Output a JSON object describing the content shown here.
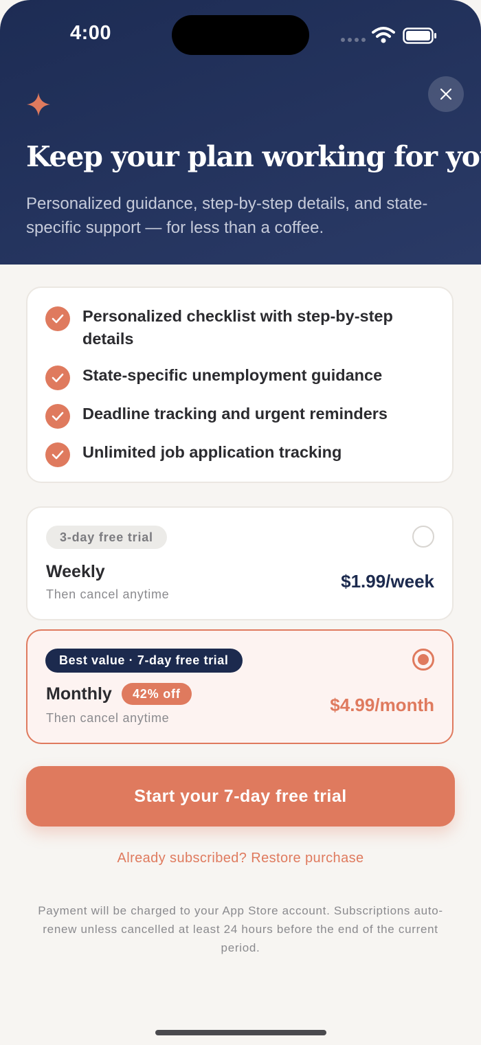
{
  "status_bar": {
    "time": "4:00"
  },
  "header": {
    "title": "Keep your plan working for you",
    "subtitle": "Personalized guidance, step-by-step details, and state-specific support — for less than a coffee.",
    "icons": {
      "sparkle": "sparkle-icon",
      "close": "close-icon"
    }
  },
  "features": [
    {
      "label": "Personalized checklist with step-by-step details"
    },
    {
      "label": "State-specific unemployment guidance"
    },
    {
      "label": "Deadline tracking and urgent reminders"
    },
    {
      "label": "Unlimited job application tracking"
    }
  ],
  "plans": {
    "weekly": {
      "badge": "3-day free trial",
      "name": "Weekly",
      "note": "Then cancel anytime",
      "price": "$1.99/week",
      "selected": false
    },
    "monthly": {
      "badge": "Best value · 7-day free trial",
      "name": "Monthly",
      "discount": "42% off",
      "note": "Then cancel anytime",
      "price": "$4.99/month",
      "selected": true
    }
  },
  "cta": {
    "label": "Start your 7-day free trial"
  },
  "restore": {
    "label": "Already subscribed? Restore purchase"
  },
  "legal": {
    "text": "Payment will be charged to your App Store account. Subscriptions auto-renew unless cancelled at least 24 hours before the end of the current period."
  },
  "colors": {
    "header_navy": "#1d2c54",
    "accent_coral": "#df7a5e",
    "badge_navy": "#1c2a4e",
    "background": "#f7f5f2"
  }
}
